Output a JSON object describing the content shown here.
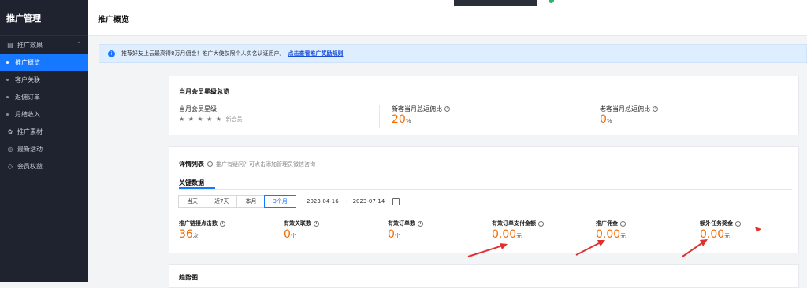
{
  "sidebar": {
    "title": "推广管理",
    "groups": [
      {
        "label": "推广效果",
        "expanded": true,
        "items": [
          "推广概览",
          "客户关联",
          "返佣订单",
          "月结收入"
        ]
      },
      {
        "label": "推广素材"
      },
      {
        "label": "最新活动"
      },
      {
        "label": "会员权益"
      }
    ],
    "active_item": "推广概览"
  },
  "header": {
    "title": "推广概览"
  },
  "notice": {
    "text": "推荐好友上云最高得8万月佣金！推广大使仅限个人实名认证用户。",
    "link": "点击查看推广奖励规则"
  },
  "member_card": {
    "title": "当月会员星级总览",
    "star_label": "当月会员星级",
    "stars": "★ ★ ★ ★ ★",
    "member_text": "新会员",
    "new_ratio_label": "新客当月总返佣比",
    "new_ratio_value": "20",
    "new_ratio_unit": "%",
    "old_ratio_label": "老客当月总返佣比",
    "old_ratio_value": "0",
    "old_ratio_unit": "%"
  },
  "detail_card": {
    "title": "详情列表",
    "hint": "推广有疑问？可点击添加管理员微信咨询",
    "tab": "关键数据",
    "ranges": [
      "当天",
      "近7天",
      "本月",
      "3个月"
    ],
    "selected_range": "3个月",
    "date_start": "2023-04-16",
    "date_sep": "~",
    "date_end": "2023-07-14",
    "stats": [
      {
        "label": "推广链接点击数",
        "value": "36",
        "unit": "次"
      },
      {
        "label": "有效关联数",
        "value": "0",
        "unit": "个"
      },
      {
        "label": "有效订单数",
        "value": "0",
        "unit": "个"
      },
      {
        "label": "有效订单支付金额",
        "value": "0.00",
        "unit": "元"
      },
      {
        "label": "推广佣金",
        "value": "0.00",
        "unit": "元"
      },
      {
        "label": "额外任务奖金",
        "value": "0.00",
        "unit": "元"
      }
    ]
  },
  "trend_card": {
    "title": "趋势图"
  },
  "colors": {
    "accent": "#1677ff",
    "value": "#f26a00",
    "sidebar": "#1f2330",
    "annotation": "#e03131"
  }
}
